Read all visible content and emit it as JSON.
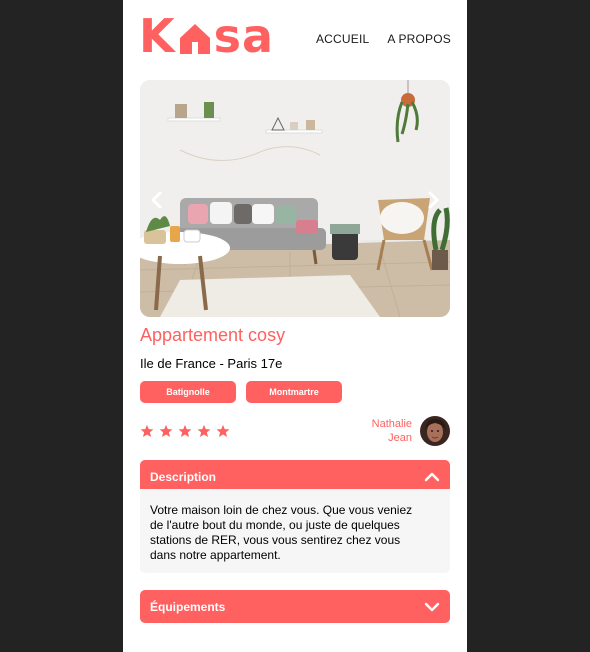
{
  "colors": {
    "brand": "#ff6060",
    "background": "#232323",
    "panel": "#f6f6f6"
  },
  "logo": {
    "left": "K",
    "right": "sa",
    "icon": "house-icon"
  },
  "nav": {
    "home": "ACCUEIL",
    "about": "A PROPOS"
  },
  "carousel": {
    "left_icon": "chevron-left-icon",
    "right_icon": "chevron-right-icon"
  },
  "listing": {
    "title": "Appartement cosy",
    "location": "Ile de France - Paris 17e",
    "tags": [
      "Batignolle",
      "Montmartre"
    ],
    "rating": 5,
    "rating_max": 5,
    "host": {
      "first_name": "Nathalie",
      "last_name": "Jean"
    }
  },
  "description": {
    "title": "Description",
    "icon": "chevron-up-icon",
    "lines": [
      "Votre maison loin de chez vous. Que vous veniez",
      "de l'autre bout du monde, ou juste de quelques",
      "stations de RER, vous vous sentirez chez vous",
      "dans notre appartement."
    ]
  },
  "equipment": {
    "title": "Équipements",
    "icon": "chevron-down-icon"
  }
}
